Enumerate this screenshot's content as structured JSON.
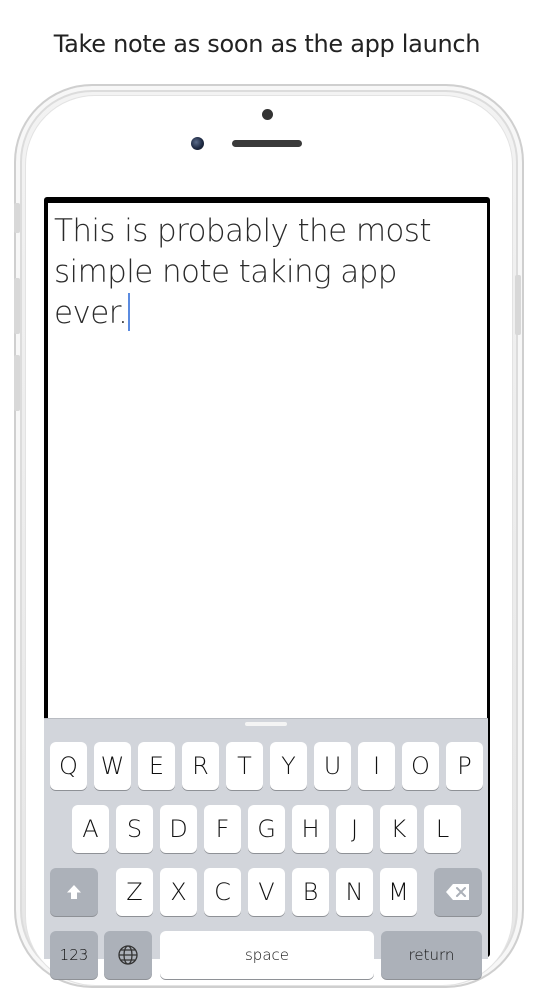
{
  "caption": "Take note as soon as the app launch",
  "note": {
    "text_line1": "This is probably the most",
    "text_line2": "simple note taking app ever."
  },
  "keyboard": {
    "row1": [
      "Q",
      "W",
      "E",
      "R",
      "T",
      "Y",
      "U",
      "I",
      "O",
      "P"
    ],
    "row2": [
      "A",
      "S",
      "D",
      "F",
      "G",
      "H",
      "J",
      "K",
      "L"
    ],
    "row3": [
      "Z",
      "X",
      "C",
      "V",
      "B",
      "N",
      "M"
    ],
    "shift_icon": "shift-arrow-icon",
    "delete_icon": "backspace-icon",
    "numbers_label": "123",
    "globe_icon": "globe-icon",
    "space_label": "space",
    "return_label": "return"
  },
  "colors": {
    "caret": "#5b8be0",
    "keyboard_bg": "#d2d5db",
    "key_bg": "#ffffff",
    "mod_key_bg": "#acb1b9"
  }
}
